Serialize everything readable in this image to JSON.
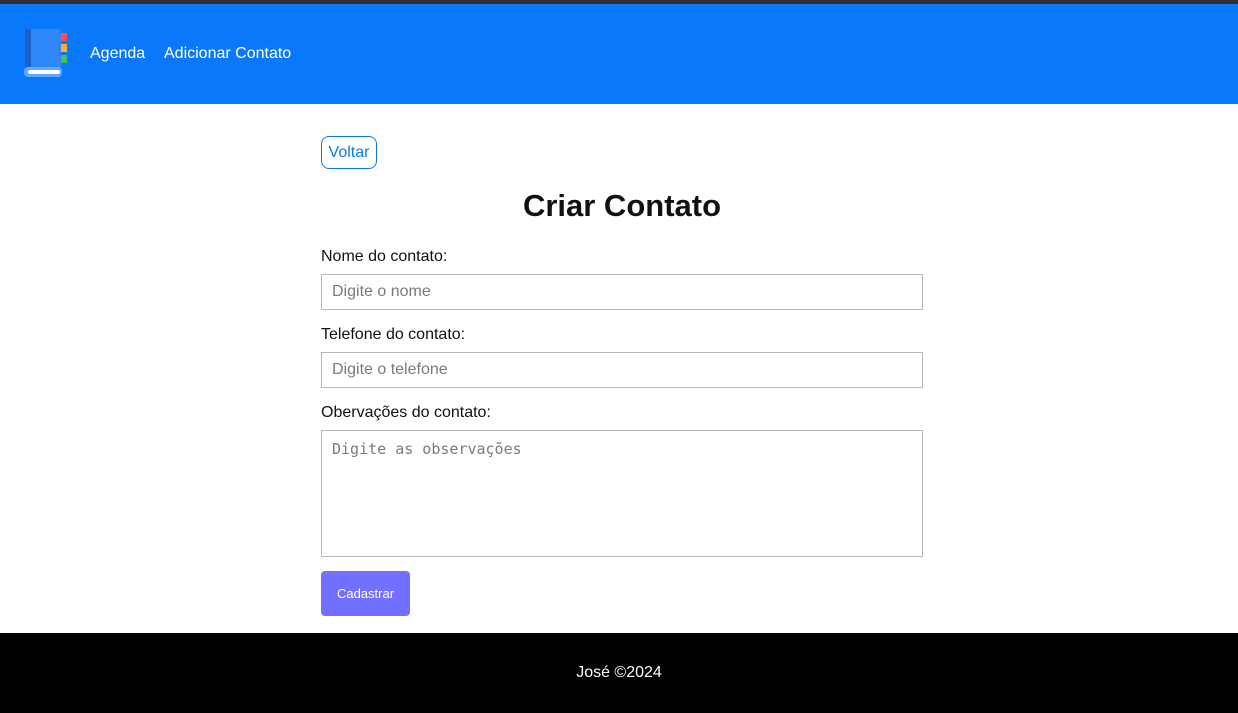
{
  "navbar": {
    "logo_icon": "address-book-icon",
    "links": [
      {
        "label": "Agenda"
      },
      {
        "label": "Adicionar Contato"
      }
    ],
    "background": "#0a78fb"
  },
  "main": {
    "back_label": "Voltar",
    "title": "Criar Contato",
    "fields": {
      "name": {
        "label": "Nome do contato:",
        "placeholder": "Digite o nome",
        "value": ""
      },
      "phone": {
        "label": "Telefone do contato:",
        "placeholder": "Digite o telefone",
        "value": ""
      },
      "notes": {
        "label": "Obervações do contato:",
        "placeholder": "Digite as observações",
        "value": ""
      }
    },
    "submit_label": "Cadastrar",
    "submit_color": "#7270ff"
  },
  "footer": {
    "text": "José ©2024"
  }
}
